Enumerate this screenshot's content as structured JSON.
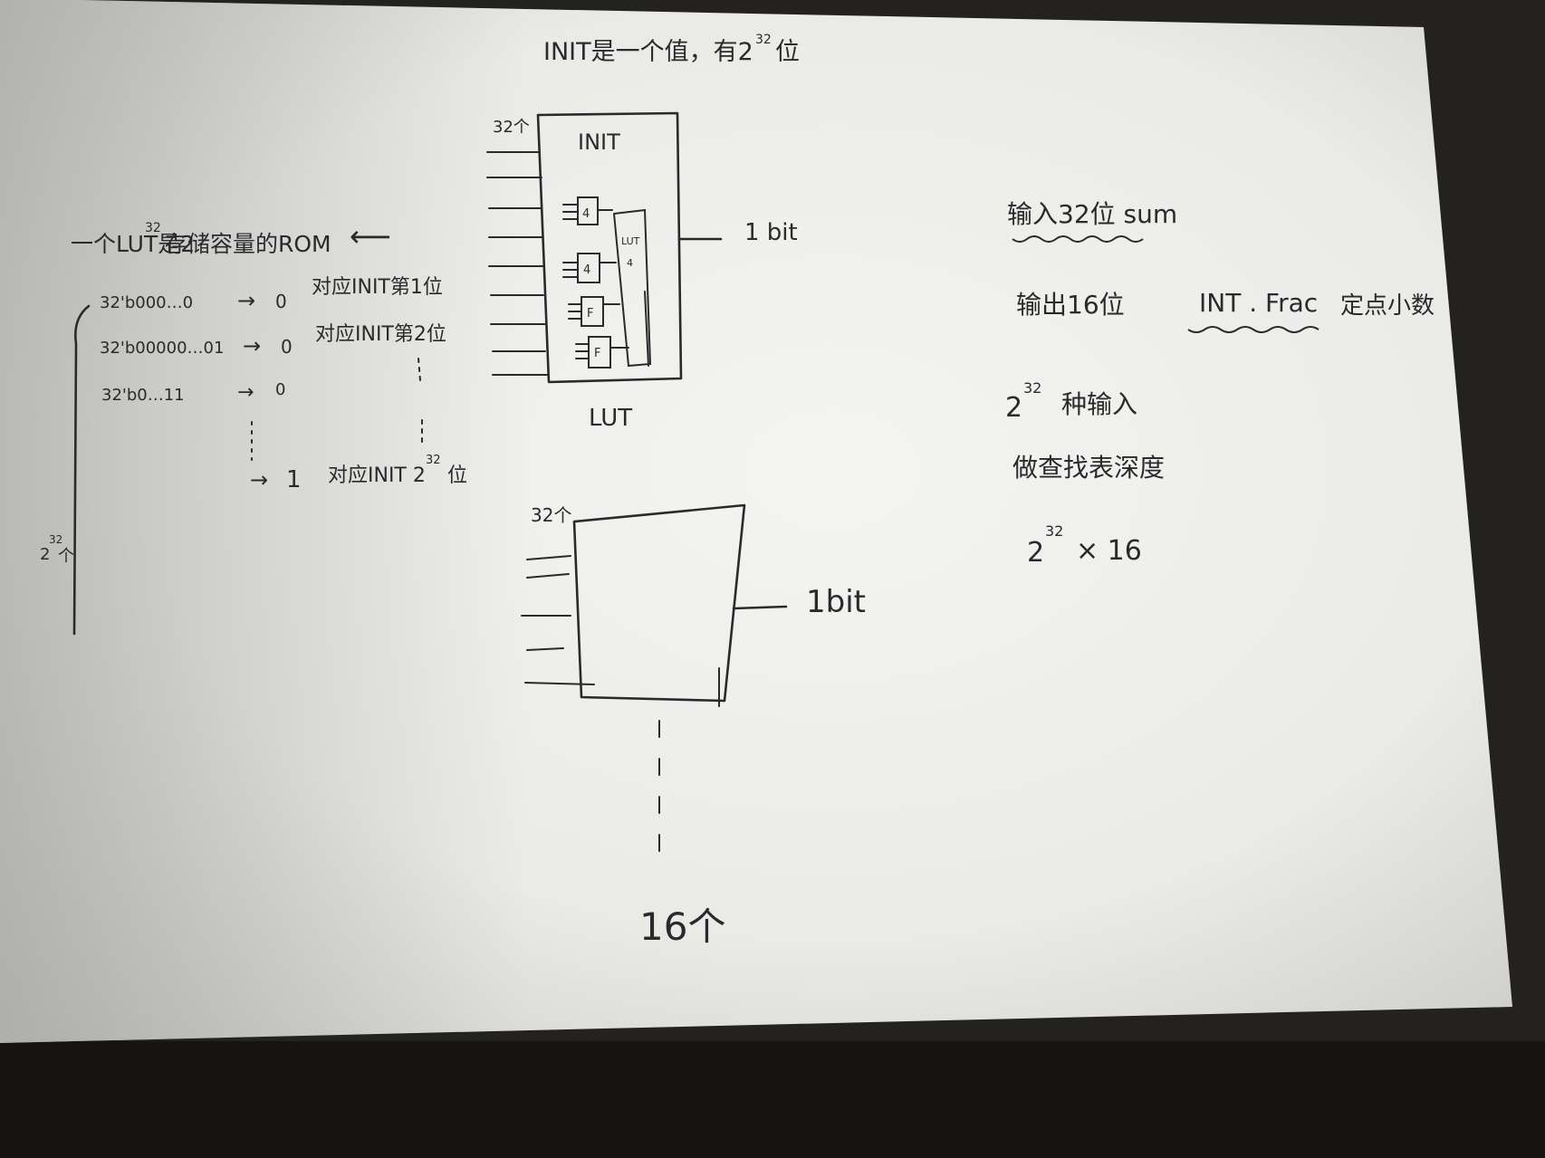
{
  "title": {
    "text": "INIT是一个值，有2",
    "exp": "32",
    "suffix": "位"
  },
  "top_diagram": {
    "input_count": "32个",
    "block_label": "INIT",
    "inner_lut_label": "LUT",
    "inner_lut_sub": "4",
    "cell_labels": [
      "4",
      "4",
      "F",
      "F"
    ],
    "output_label": "1 bit",
    "caption": "LUT"
  },
  "rom_note": {
    "prefix": "一个LUT是2",
    "exp": "32",
    "suffix": "存储容量的ROM",
    "arrow": "⟵"
  },
  "rom_rows": [
    {
      "addr": "32'b000…0",
      "arrow": "→",
      "value": "0",
      "note": "对应INIT第1位"
    },
    {
      "addr": "32'b00000…01",
      "arrow": "→",
      "value": "0",
      "note": "对应INIT第2位"
    },
    {
      "addr": "32'b0…11",
      "arrow": "→",
      "value": "0",
      "note": ""
    }
  ],
  "rom_last_row": {
    "arrow": "→",
    "value": "1",
    "note_prefix": "对应INIT 2",
    "note_exp": "32",
    "note_suffix": "位"
  },
  "depth_label": {
    "base": "2",
    "exp": "32",
    "suffix": "个"
  },
  "bottom_diagram": {
    "input_count": "32个",
    "output_label": "1bit",
    "stack_count": "16个"
  },
  "right_notes": {
    "input_line": "输入32位  sum",
    "output_prefix": "输出16位",
    "output_format": "INT . Frac",
    "output_suffix": "定点小数",
    "combos_base": "2",
    "combos_exp": "32",
    "combos_suffix": "种输入",
    "table_depth": "做查找表深度",
    "formula_base": "2",
    "formula_exp": "32",
    "formula_suffix": "× 16"
  }
}
